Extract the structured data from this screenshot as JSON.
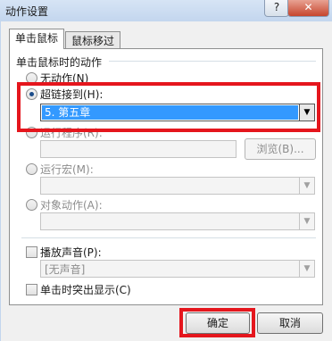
{
  "window": {
    "title": "动作设置",
    "help": "?",
    "close": "✕"
  },
  "tabs": [
    {
      "label": "单击鼠标",
      "active": true
    },
    {
      "label": "鼠标移过",
      "active": false
    }
  ],
  "group": {
    "label": "单击鼠标时的动作"
  },
  "options": {
    "none": {
      "label": "无动作(N)",
      "checked": false
    },
    "hyperlink": {
      "label": "超链接到(H):",
      "checked": true,
      "value": "5. 第五章"
    },
    "run_program": {
      "label": "运行程序(R):",
      "value": "",
      "browse": "浏览(B)..."
    },
    "run_macro": {
      "label": "运行宏(M):",
      "value": ""
    },
    "object_action": {
      "label": "对象动作(A):",
      "value": ""
    }
  },
  "sound": {
    "label": "播放声音(P):",
    "value": "[无声音]"
  },
  "highlight_click": {
    "label": "单击时突出显示(C)"
  },
  "buttons": {
    "ok": "确定",
    "cancel": "取消"
  },
  "colors": {
    "annotation": "#e5161d",
    "selection": "#3399ff"
  }
}
